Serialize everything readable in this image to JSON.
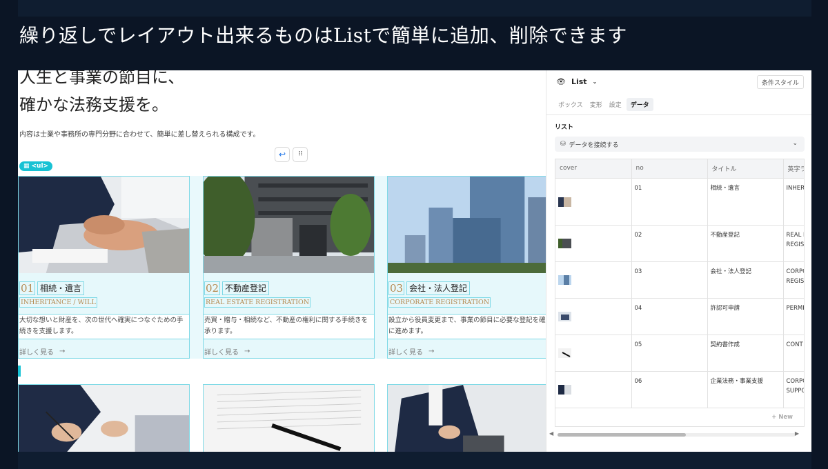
{
  "caption": "繰り返しでレイアウト出来るものはListで簡単に追加、削除できます",
  "canvas": {
    "hero_title_line1": "人生と事業の節目に、",
    "hero_title_line2": "確かな法務支援を。",
    "hero_desc": "内容は士業や事務所の専門分野に合わせて、簡単に差し替えられる構成です。",
    "ul_tag": "<ul>",
    "cards": [
      {
        "num": "01",
        "title": "相続・遺言",
        "en": "INHERITANCE / WILL",
        "desc": "大切な想いと財産を、次の世代へ確実につなぐための手続きを支援します。",
        "more": "詳しく見る"
      },
      {
        "num": "02",
        "title": "不動産登記",
        "en": "REAL ESTATE REGISTRATION",
        "desc": "売買・贈与・相続など、不動産の権利に関する手続きを承ります。",
        "more": "詳しく見る"
      },
      {
        "num": "03",
        "title": "会社・法人登記",
        "en": "CORPORATE REGISTRATION",
        "desc": "設立から役員変更まで、事業の節目に必要な登記を確に進めます。",
        "more": "詳しく見る"
      }
    ]
  },
  "panel": {
    "component": "List",
    "style_button": "条件スタイル",
    "tabs": [
      "ボックス",
      "変形",
      "設定",
      "データ"
    ],
    "active_tab": "データ",
    "section_label": "リスト",
    "connect_label": "データを接続する",
    "columns": [
      "cover",
      "no",
      "タイトル",
      "英字ラ"
    ],
    "rows": [
      {
        "no": "01",
        "title": "相続・遺言",
        "en1": "INHER",
        "en2": ""
      },
      {
        "no": "02",
        "title": "不動産登記",
        "en1": "REAL E",
        "en2": "REGIST"
      },
      {
        "no": "03",
        "title": "会社・法人登記",
        "en1": "CORPO",
        "en2": "REGIST"
      },
      {
        "no": "04",
        "title": "許認可申請",
        "en1": "PERMI",
        "en2": ""
      },
      {
        "no": "05",
        "title": "契約書作成",
        "en1": "CONT",
        "en2": ""
      },
      {
        "no": "06",
        "title": "企業法務・事業支援",
        "en1": "CORPO",
        "en2": "SUPPO"
      }
    ],
    "new_row": "+ New"
  }
}
